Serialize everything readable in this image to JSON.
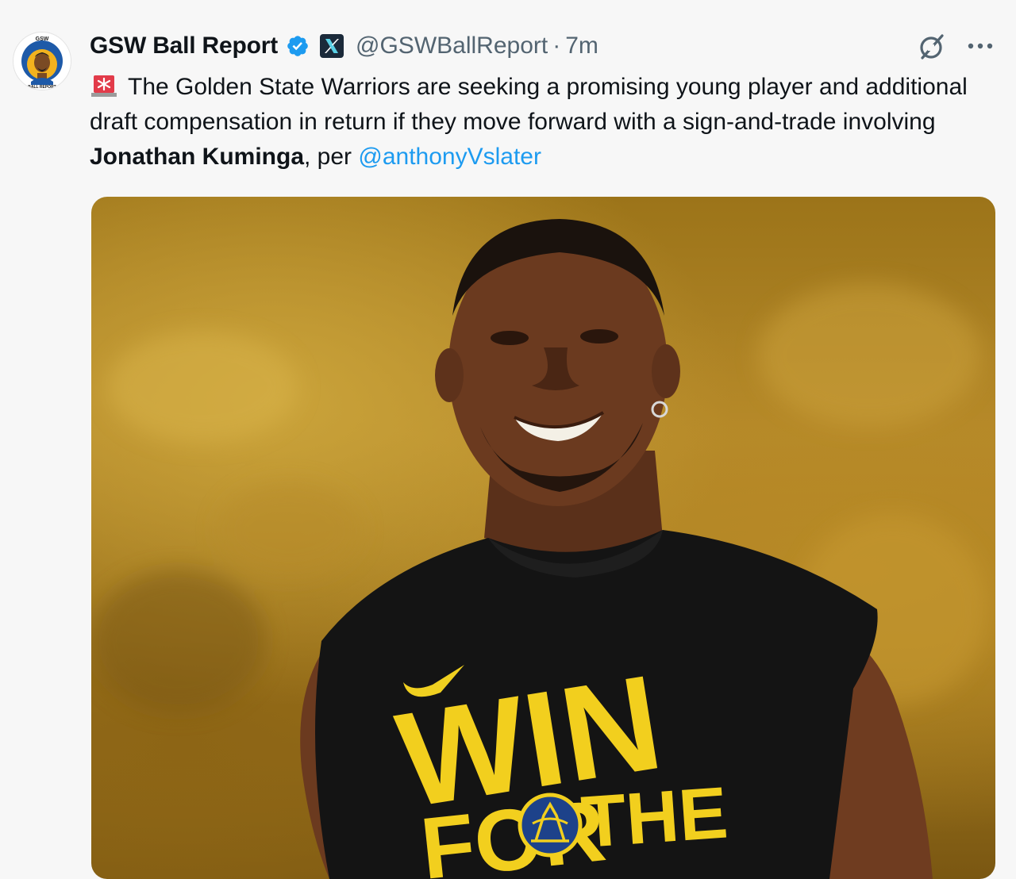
{
  "tweet": {
    "display_name": "GSW Ball Report",
    "handle": "@GSWBallReport",
    "separator": "·",
    "time": "7m",
    "text": {
      "part1": "The Golden State Warriors are seeking a promising young player and additional draft compensation in return if they move forward with a sign-and-trade involving ",
      "bold": "Jonathan Kuminga",
      "part2": ", per ",
      "mention": "@anthonyVslater"
    },
    "avatar_lettering_top": "GSW",
    "avatar_lettering_bottom": "BALL REPORT",
    "shirt_lettering": [
      "WIN",
      "FOR",
      "THE"
    ]
  },
  "icons": {
    "verified": "verified-badge-icon",
    "x_logo": "x-logo-icon",
    "grok": "grok-icon",
    "more": "more-options-icon",
    "siren": "siren-emoji-icon"
  },
  "colors": {
    "link": "#1d9bf0",
    "verified": "#1d9bf0",
    "secondary_text": "#536471",
    "primary_text": "#0f1419"
  }
}
